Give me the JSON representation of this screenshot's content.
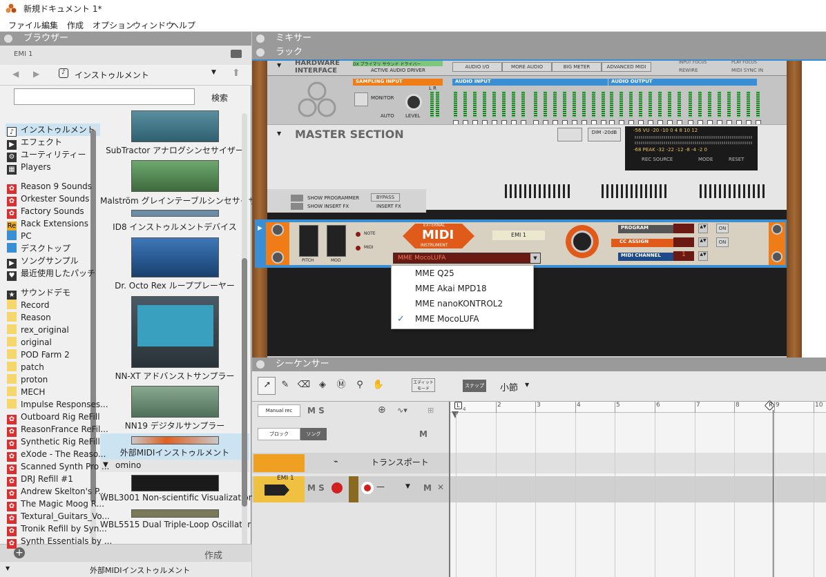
{
  "window": {
    "title": "新規ドキュメント 1*"
  },
  "menu": [
    "ファイル",
    "編集",
    "作成",
    "オプション",
    "ウィンドウ",
    "ヘルプ"
  ],
  "browser": {
    "header": "ブラウザー",
    "location": "EMI 1",
    "nav_path": "インストゥルメント",
    "search_placeholder": "",
    "search_button": "検索",
    "categories": [
      {
        "label": "インストゥルメント",
        "icon": "instrument-icon",
        "selected": true
      },
      {
        "label": "エフェクト",
        "icon": "effect-icon"
      },
      {
        "label": "ユーティリティー",
        "icon": "utility-icon"
      },
      {
        "label": "Players",
        "icon": "players-icon"
      },
      {
        "label": "Reason 9 Sounds",
        "icon": "refill-icon"
      },
      {
        "label": "Orkester Sounds",
        "icon": "refill-icon"
      },
      {
        "label": "Factory Sounds",
        "icon": "refill-icon"
      },
      {
        "label": "Rack Extensions",
        "icon": "re-icon"
      },
      {
        "label": "PC",
        "icon": "pc-icon"
      },
      {
        "label": "デスクトップ",
        "icon": "desktop-icon"
      },
      {
        "label": "ソングサンプル",
        "icon": "song-sample-icon"
      },
      {
        "label": "最近使用したパッチ",
        "icon": "recent-icon"
      },
      {
        "label": "サウンドデモ",
        "icon": "star-icon"
      },
      {
        "label": "Record",
        "icon": "folder-icon"
      },
      {
        "label": "Reason",
        "icon": "folder-icon"
      },
      {
        "label": "rex_original",
        "icon": "folder-icon"
      },
      {
        "label": "original",
        "icon": "folder-icon"
      },
      {
        "label": "POD Farm 2",
        "icon": "folder-icon"
      },
      {
        "label": "patch",
        "icon": "folder-icon"
      },
      {
        "label": "proton",
        "icon": "folder-icon"
      },
      {
        "label": "MECH",
        "icon": "folder-icon"
      },
      {
        "label": "Impulse Responses...",
        "icon": "folder-icon"
      },
      {
        "label": "Outboard Rig ReFill",
        "icon": "refill-icon"
      },
      {
        "label": "ReasonFrance ReFil...",
        "icon": "refill-icon"
      },
      {
        "label": "Synthetic Rig ReFill",
        "icon": "refill-icon"
      },
      {
        "label": "eXode - The Reaso...",
        "icon": "refill-icon"
      },
      {
        "label": "Scanned Synth Pro ...",
        "icon": "refill-icon"
      },
      {
        "label": "DRJ Refill #1",
        "icon": "refill-icon"
      },
      {
        "label": "Andrew Skelton's P...",
        "icon": "refill-icon"
      },
      {
        "label": "The Magic Moog R...",
        "icon": "refill-icon"
      },
      {
        "label": "Textural_Guitars_Vo...",
        "icon": "refill-icon"
      },
      {
        "label": "Tronik Refill by Syn...",
        "icon": "refill-icon"
      },
      {
        "label": "Synth Essentials by ...",
        "icon": "refill-icon"
      }
    ],
    "devices": [
      "SubTractor アナログシンセサイザー",
      "Malström グレインテーブルシンセサイザー",
      "ID8 インストゥルメントデバイス",
      "Dr. Octo Rex ループプレーヤー",
      "NN-XT アドバンストサンプラー",
      "NN19 デジタルサンプラー",
      "外部MIDIインストゥルメント"
    ],
    "group_label": "omino",
    "group_devices": [
      "WBL3001 Non-scientific Visualization",
      "WBL5515 Dual Triple-Loop Oscillator"
    ],
    "create_button": "作成",
    "status": "外部MIDIインストゥルメント"
  },
  "mixer": {
    "header": "ミキサー"
  },
  "rack": {
    "header": "ラック",
    "hw_interface": {
      "title": "HARDWARE INTERFACE",
      "driver_value": "DX プライマリ サウンド ドライバー",
      "driver_label": "ACTIVE AUDIO DRIVER",
      "tabs": [
        "AUDIO I/O",
        "MORE AUDIO",
        "BIG METER",
        "ADVANCED MIDI"
      ],
      "options": [
        "INPUT FOCUS",
        "PLAY FOCUS",
        "REWIRE",
        "MIDI SYNC IN"
      ],
      "sampling_input": "SAMPLING INPUT",
      "monitor": "MONITOR",
      "auto": "AUTO",
      "level": "LEVEL",
      "audio_input": "AUDIO INPUT",
      "audio_output": "AUDIO OUTPUT",
      "lr": "L R"
    },
    "master": {
      "title": "MASTER SECTION",
      "dim": "DIM -20dB",
      "meter_scale_top": "-56 VU -20 -10 0 4 8 10 12",
      "meter_scale_bottom": "-68 PEAK -32 -22 -12 -8 -4 -2 0",
      "rec_source": "REC SOURCE",
      "mode": "MODE",
      "reset": "RESET",
      "show_programmer": "SHOW PROGRAMMER",
      "show_insert_fx": "SHOW INSERT FX",
      "bypass": "BYPASS",
      "insert_fx": "INSERT FX"
    },
    "ext_midi": {
      "logo_top": "EXTERNAL",
      "logo_main": "MIDI",
      "logo_bottom": "INSTRUMENT",
      "name": "EMI 1",
      "pitch": "PITCH",
      "mod": "MOD",
      "note": "NOTE",
      "midi": "MIDI",
      "port_value": "MME MocoLUFA",
      "program": "PROGRAM",
      "cc_assign": "CC ASSIGN",
      "midi_channel": "MIDI CHANNEL",
      "channel_value": "1",
      "on": "ON"
    },
    "port_options": [
      {
        "label": "MME Q25",
        "checked": false
      },
      {
        "label": "MME Akai MPD18",
        "checked": false
      },
      {
        "label": "MME nanoKONTROL2",
        "checked": false
      },
      {
        "label": "MME MocoLUFA",
        "checked": true
      }
    ]
  },
  "sequencer": {
    "header": "シーケンサー",
    "edit_mode": "エディット モード",
    "snap": "スナップ",
    "snap_value": "小節",
    "manual_rec": "Manual rec",
    "ms": "M S",
    "block": "ブロック",
    "song": "ソング",
    "m": "M",
    "transport": "トランスポート",
    "track_name": "EMI 1",
    "bar_numbers": [
      "1",
      "2",
      "3",
      "4",
      "5",
      "6",
      "7",
      "8",
      "9",
      "10"
    ],
    "loop_start": "L",
    "loop_end": "R",
    "sub_marker": "4"
  },
  "colors": {
    "accent_blue": "#3a8fd4",
    "orange": "#f07c18",
    "selected_bg": "#cce4f2"
  }
}
